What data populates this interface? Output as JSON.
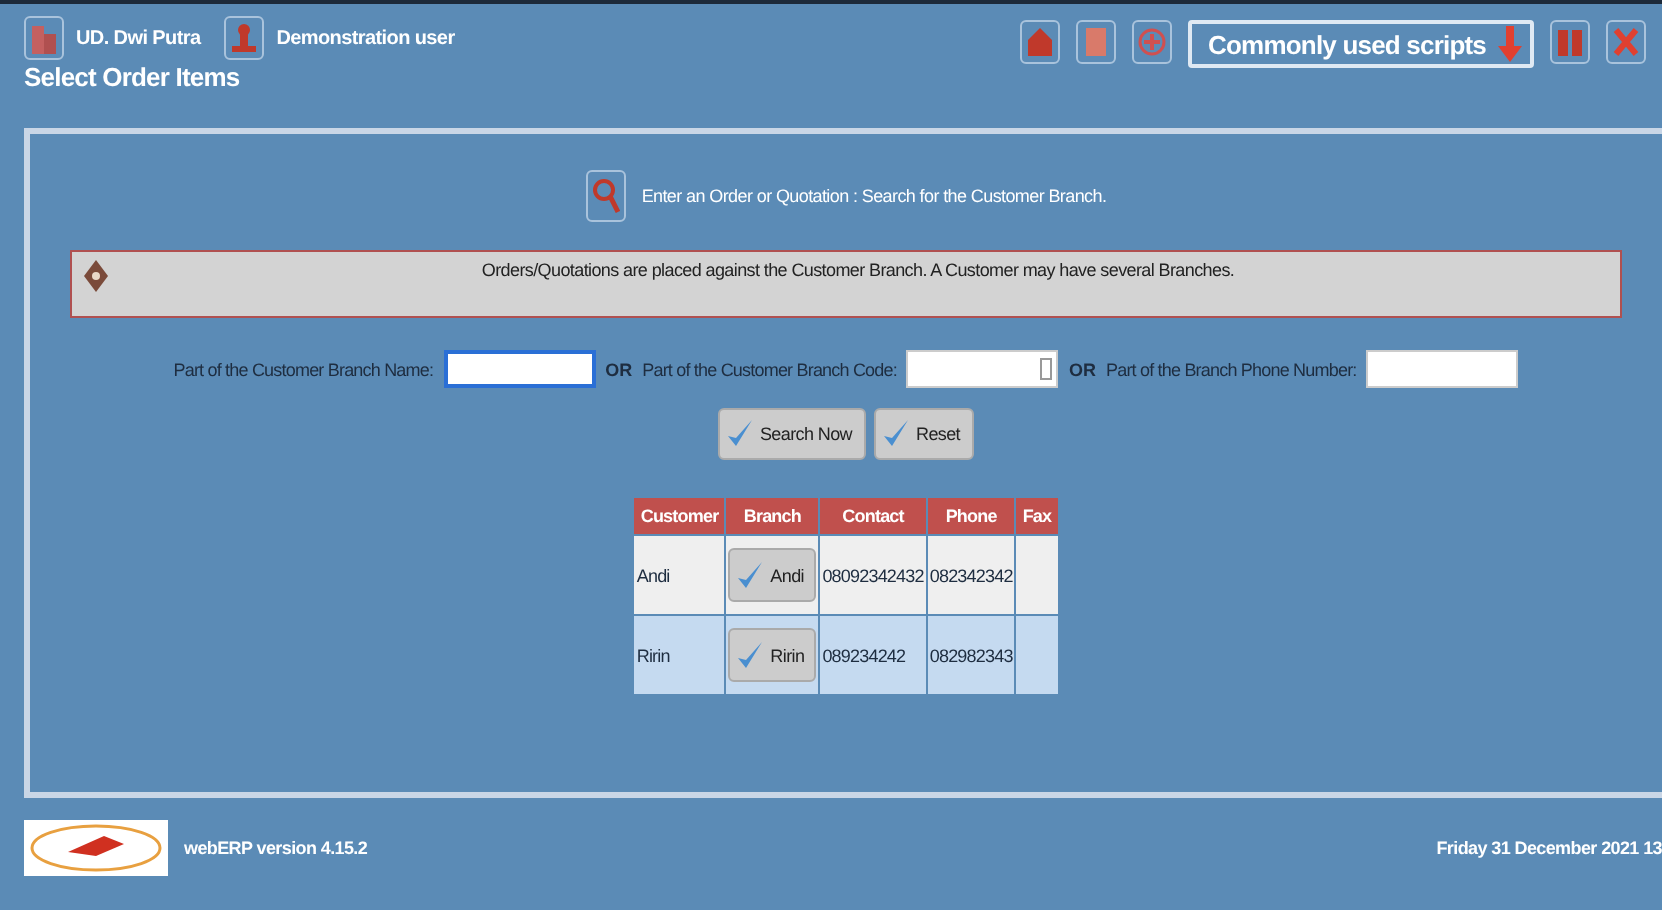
{
  "header": {
    "company": "UD. Dwi Putra",
    "user": "Demonstration user",
    "title": "Select Order Items",
    "scripts_button": "Commonly used scripts"
  },
  "search": {
    "heading": "Enter an Order or Quotation : Search for the Customer Branch.",
    "info": "Orders/Quotations are placed against the Customer Branch. A Customer may have several Branches.",
    "fields": [
      {
        "label": "Part of the Customer Branch Name:",
        "focused": true,
        "spinner": false
      },
      {
        "separator": "OR",
        "label": "Part of the Customer Branch Code:",
        "focused": false,
        "spinner": true
      },
      {
        "separator": "OR",
        "label": "Part of the Branch Phone Number:",
        "focused": false,
        "spinner": false
      }
    ],
    "buttons": [
      "Search Now",
      "Reset"
    ]
  },
  "table": {
    "columns": [
      "Customer",
      "Branch",
      "Contact",
      "Phone",
      "Fax"
    ],
    "rows": [
      {
        "customer": "Andi",
        "branch": "Andi",
        "contact": "08092342432",
        "phone": "082342342"
      },
      {
        "customer": "Ririn",
        "branch": "Ririn",
        "contact": "089234242",
        "phone": "082982343"
      }
    ]
  },
  "footer": {
    "version": "webERP version 4.15.2",
    "date": "Friday 31 December 2021 13"
  }
}
